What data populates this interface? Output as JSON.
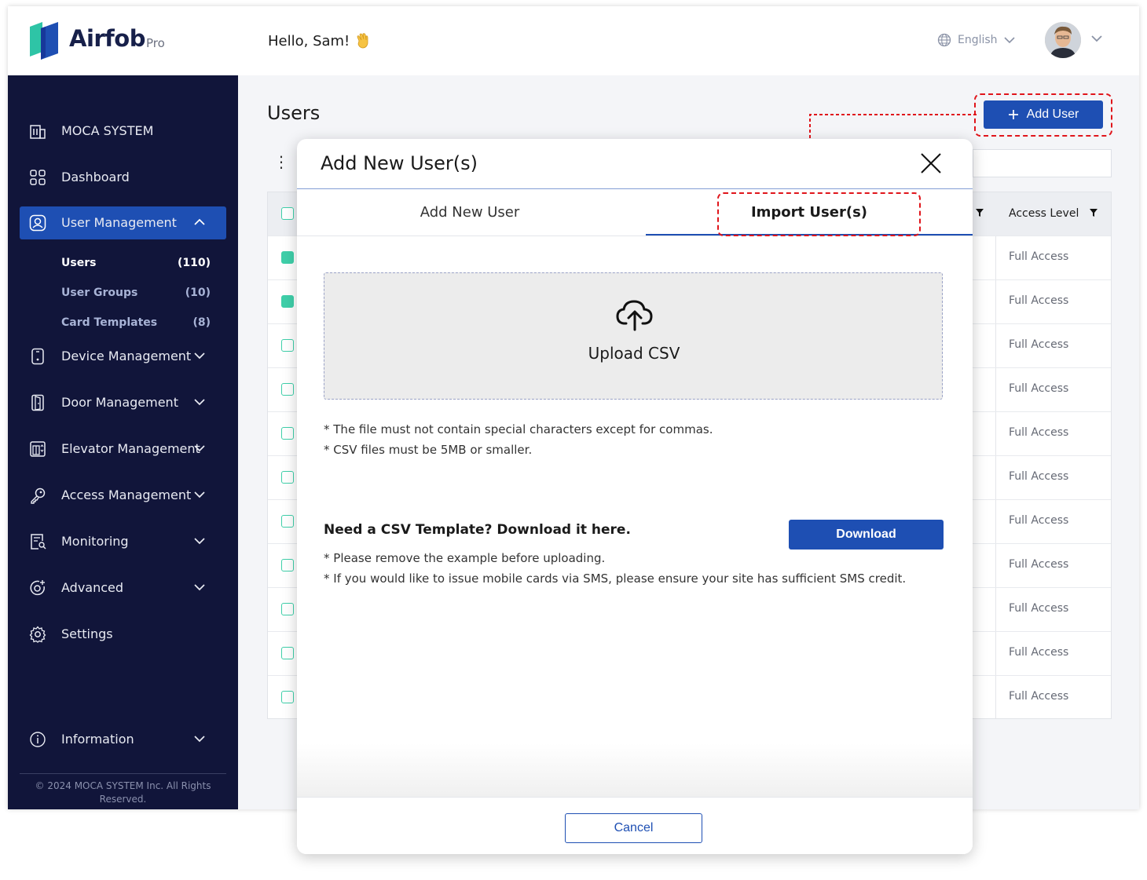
{
  "brand": {
    "name": "Airfob",
    "tier": "Pro"
  },
  "header": {
    "greeting": "Hello, Sam!",
    "language": "English"
  },
  "sidebar": {
    "items": [
      {
        "label": "MOCA SYSTEM"
      },
      {
        "label": "Dashboard"
      },
      {
        "label": "User Management"
      },
      {
        "label": "Device Management"
      },
      {
        "label": "Door Management"
      },
      {
        "label": "Elevator Management"
      },
      {
        "label": "Access Management"
      },
      {
        "label": "Monitoring"
      },
      {
        "label": "Advanced"
      },
      {
        "label": "Settings"
      },
      {
        "label": "Information"
      }
    ],
    "sub_items": [
      {
        "label": "Users",
        "count": "(110)"
      },
      {
        "label": "User Groups",
        "count": "(10)"
      },
      {
        "label": "Card Templates",
        "count": "(8)"
      }
    ],
    "copyright": "© 2024 MOCA SYSTEM Inc. All Rights Reserved."
  },
  "main": {
    "title": "Users",
    "add_user_label": "Add User",
    "table": {
      "access_level_header": "Access Level",
      "rows": [
        {
          "access": "Full Access",
          "checked": true
        },
        {
          "access": "Full Access",
          "checked": true
        },
        {
          "access": "Full Access",
          "checked": false
        },
        {
          "access": "Full Access",
          "checked": false
        },
        {
          "access": "Full Access",
          "checked": false
        },
        {
          "access": "Full Access",
          "checked": false
        },
        {
          "access": "Full Access",
          "checked": false
        },
        {
          "access": "Full Access",
          "checked": false
        },
        {
          "access": "Full Access",
          "checked": false
        },
        {
          "access": "Full Access",
          "checked": false
        },
        {
          "access": "Full Access",
          "checked": false
        }
      ]
    }
  },
  "modal": {
    "title": "Add New User(s)",
    "tabs": [
      "Add New User",
      "Import User(s)"
    ],
    "upload_label": "Upload CSV",
    "notes": [
      "* The file must not contain special characters except for commas.",
      "* CSV files must be 5MB or smaller."
    ],
    "template_question": "Need a CSV Template? Download it here.",
    "download_label": "Download",
    "template_notes": [
      "* Please remove the example before uploading.",
      "* If you would like to issue mobile cards via SMS, please ensure your site has sufficient SMS credit."
    ],
    "cancel_label": "Cancel"
  },
  "colors": {
    "primary": "#1e4fb3",
    "sidebar_bg": "#11153a",
    "checkbox": "#3fcfa9",
    "annotation": "#e0151b"
  }
}
